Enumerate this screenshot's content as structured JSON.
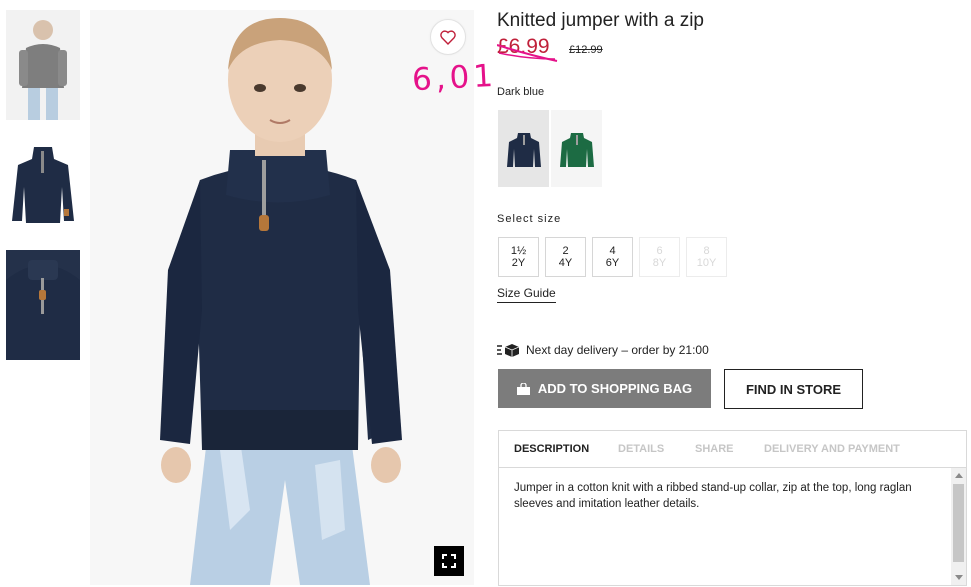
{
  "product": {
    "title": "Knitted jumper with a zip",
    "price": "£6.99",
    "original_price": "£12.99",
    "handwritten_annotation": "6,01",
    "color_label": "Dark blue",
    "swatches": [
      {
        "name": "Dark blue",
        "color": "#1f2c45",
        "selected": true
      },
      {
        "name": "Green",
        "color": "#1c6b43",
        "selected": false
      }
    ]
  },
  "sizes": {
    "label": "Select size",
    "options": [
      {
        "line1": "1½",
        "line2": "2Y",
        "available": true
      },
      {
        "line1": "2",
        "line2": "4Y",
        "available": true
      },
      {
        "line1": "4",
        "line2": "6Y",
        "available": true
      },
      {
        "line1": "6",
        "line2": "8Y",
        "available": false
      },
      {
        "line1": "8",
        "line2": "10Y",
        "available": false
      }
    ],
    "guide_label": "Size Guide"
  },
  "delivery": {
    "text": "Next day delivery – order by 21:00",
    "icon": "delivery-box-icon"
  },
  "actions": {
    "add_to_bag": "ADD TO SHOPPING BAG",
    "find_in_store": "FIND IN STORE",
    "add_button_color": "#7c7c7c"
  },
  "tabs": [
    {
      "label": "DESCRIPTION",
      "active": true
    },
    {
      "label": "DETAILS",
      "active": false
    },
    {
      "label": "SHARE",
      "active": false
    },
    {
      "label": "DELIVERY AND PAYMENT",
      "active": false
    }
  ],
  "description": "Jumper in a cotton knit with a ribbed stand-up collar, zip at the top, long raglan sleeves and imitation leather details.",
  "colors": {
    "price_red": "#c0203a",
    "annotation_pink": "#e5128a",
    "jumper_navy": "#1f2c45"
  }
}
